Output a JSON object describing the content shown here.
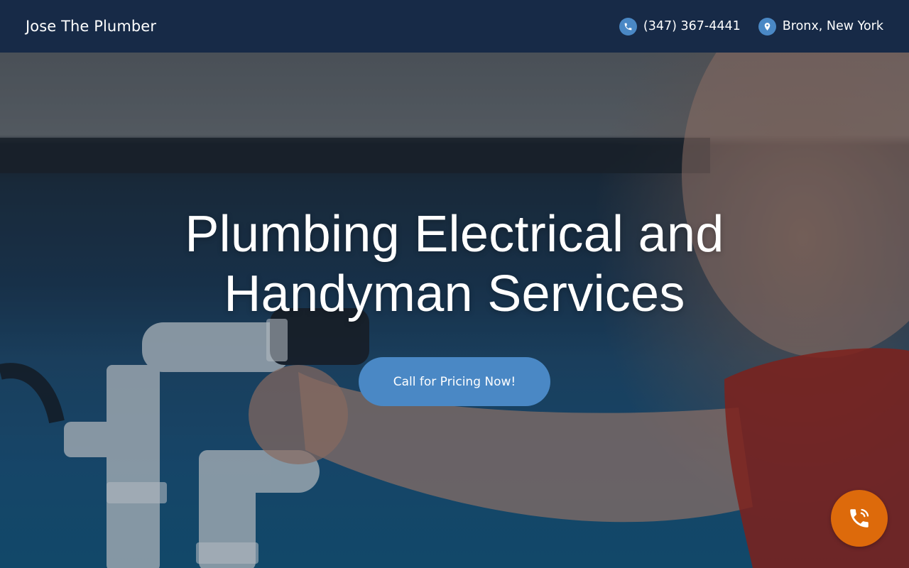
{
  "header": {
    "brand": "Jose The Plumber",
    "phone": {
      "icon": "phone-icon",
      "label": "(347) 367-4441"
    },
    "location": {
      "icon": "map-pin-icon",
      "label": "Bronx, New York"
    }
  },
  "hero": {
    "title_line1": "Plumbing Electrical and",
    "title_line2": "Handyman Services",
    "cta_label": "Call for Pricing Now!",
    "image": "plumber-fixing-sink-pipes"
  },
  "floating_call": {
    "icon": "phone-call-icon"
  },
  "colors": {
    "header_bg": "#172a47",
    "accent_blue": "#4a88c5",
    "call_orange": "#dd6a0b",
    "text": "#ffffff"
  }
}
